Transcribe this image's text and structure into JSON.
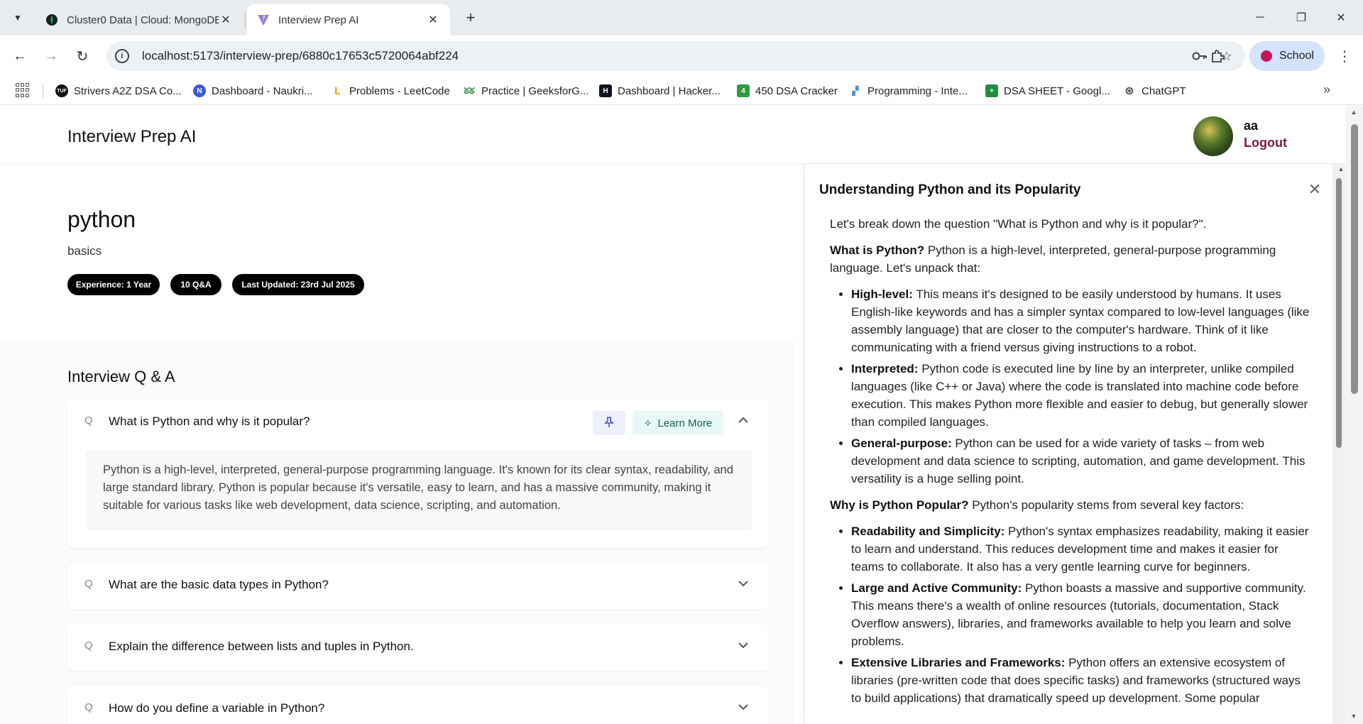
{
  "browser": {
    "tabs": [
      {
        "title": "Cluster0 Data | Cloud: MongoDB",
        "active": false
      },
      {
        "title": "Interview Prep AI",
        "active": true
      }
    ],
    "url": "localhost:5173/interview-prep/6880c17653c5720064abf224",
    "profile_label": "School",
    "bookmarks": [
      {
        "label": "Strivers A2Z DSA Co...",
        "icon_color": "#111111",
        "icon_text": "TUF"
      },
      {
        "label": "Dashboard - Naukri...",
        "icon_color": "#3b5bdb",
        "icon_text": "N"
      },
      {
        "label": "Problems - LeetCode",
        "icon_color": "#f5a623",
        "icon_text": "L"
      },
      {
        "label": "Practice | GeeksforG...",
        "icon_color": "#2f8d46",
        "icon_text": "G"
      },
      {
        "label": "Dashboard | Hacker...",
        "icon_color": "#0e141e",
        "icon_text": "H"
      },
      {
        "label": "450 DSA Cracker",
        "icon_color": "#2e9b3e",
        "icon_text": "4"
      },
      {
        "label": "Programming - Inte...",
        "icon_color": "#4a90d9",
        "icon_text": "P"
      },
      {
        "label": "DSA SHEET - Googl...",
        "icon_color": "#1e8e3e",
        "icon_text": "+"
      },
      {
        "label": "ChatGPT",
        "icon_color": "#444444",
        "icon_text": "⊛"
      }
    ]
  },
  "app": {
    "title": "Interview Prep AI",
    "user_name": "aa",
    "logout_label": "Logout"
  },
  "session": {
    "role": "python",
    "topic": "basics",
    "pills": [
      "Experience: 1 Year",
      "10 Q&A",
      "Last Updated: 23rd Jul 2025"
    ]
  },
  "qa": {
    "heading": "Interview Q & A",
    "learn_more_label": "Learn More",
    "items": [
      {
        "question": "What is Python and why is it popular?",
        "answer": "Python is a high-level, interpreted, general-purpose programming language. It's known for its clear syntax, readability, and large standard library. Python is popular because it's versatile, easy to learn, and has a massive community, making it suitable for various tasks like web development, data science, scripting, and automation.",
        "expanded": true
      },
      {
        "question": "What are the basic data types in Python?",
        "expanded": false
      },
      {
        "question": "Explain the difference between lists and tuples in Python.",
        "expanded": false
      },
      {
        "question": "How do you define a variable in Python?",
        "expanded": false
      }
    ]
  },
  "drawer": {
    "title": "Understanding Python and its Popularity",
    "intro": "Let's break down the question \"What is Python and why is it popular?\".",
    "what_heading": "What is Python?",
    "what_text": " Python is a high-level, interpreted, general-purpose programming language. Let's unpack that:",
    "what_points": [
      {
        "term": "High-level:",
        "text": " This means it's designed to be easily understood by humans. It uses English-like keywords and has a simpler syntax compared to low-level languages (like assembly language) that are closer to the computer's hardware. Think of it like communicating with a friend versus giving instructions to a robot."
      },
      {
        "term": "Interpreted:",
        "text": " Python code is executed line by line by an interpreter, unlike compiled languages (like C++ or Java) where the code is translated into machine code before execution. This makes Python more flexible and easier to debug, but generally slower than compiled languages."
      },
      {
        "term": "General-purpose:",
        "text": " Python can be used for a wide variety of tasks – from web development and data science to scripting, automation, and game development. This versatility is a huge selling point."
      }
    ],
    "why_heading": "Why is Python Popular?",
    "why_text": " Python's popularity stems from several key factors:",
    "why_points": [
      {
        "term": "Readability and Simplicity:",
        "text": " Python's syntax emphasizes readability, making it easier to learn and understand. This reduces development time and makes it easier for teams to collaborate. It also has a very gentle learning curve for beginners."
      },
      {
        "term": "Large and Active Community:",
        "text": " Python boasts a massive and supportive community. This means there's a wealth of online resources (tutorials, documentation, Stack Overflow answers), libraries, and frameworks available to help you learn and solve problems."
      },
      {
        "term": "Extensive Libraries and Frameworks:",
        "text": " Python offers an extensive ecosystem of libraries (pre-written code that does specific tasks) and frameworks (structured ways to build applications) that dramatically speed up development. Some popular"
      }
    ]
  }
}
